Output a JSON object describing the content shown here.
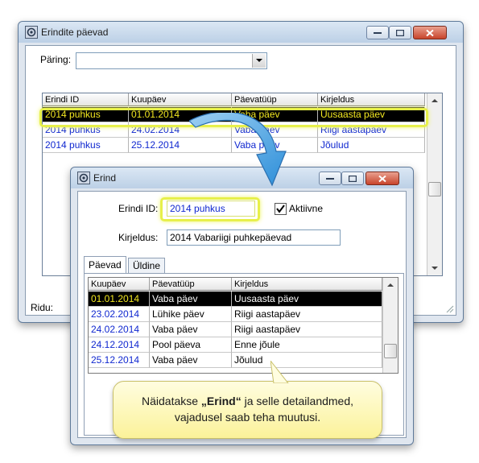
{
  "main_window": {
    "title": "Erindite päevad",
    "query_label": "Päring:",
    "query_value": "",
    "columns": [
      "Erindi ID",
      "Kuupäev",
      "Päevatüüp",
      "Kirjeldus"
    ],
    "rows": [
      [
        "2014 puhkus",
        "01.01.2014",
        "Vaba päev",
        "Uusaasta päev"
      ],
      [
        "2014 puhkus",
        "24.02.2014",
        "Vaba päev",
        "Riigi aastapäev"
      ],
      [
        "2014 puhkus",
        "25.12.2014",
        "Vaba päev",
        "Jõulud"
      ]
    ],
    "status_label": "Ridu:"
  },
  "detail_window": {
    "title": "Erind",
    "id_label": "Erindi ID:",
    "id_value": "2014 puhkus",
    "active_label": "Aktiivne",
    "active_checked": true,
    "desc_label": "Kirjeldus:",
    "desc_value": "2014 Vabariigi puhkepäevad",
    "tabs": [
      "Päevad",
      "Üldine"
    ],
    "columns": [
      "Kuupäev",
      "Päevatüüp",
      "Kirjeldus"
    ],
    "rows": [
      [
        "01.01.2014",
        "Vaba päev",
        "Uusaasta päev"
      ],
      [
        "23.02.2014",
        "Lühike päev",
        "Riigi aastapäev"
      ],
      [
        "24.02.2014",
        "Vaba päev",
        "Riigi aastapäev"
      ],
      [
        "24.12.2014",
        "Pool päeva",
        "Enne jõule"
      ],
      [
        "25.12.2014",
        "Vaba päev",
        "Jõulud"
      ]
    ]
  },
  "callout": {
    "line1_prefix": "Näidatakse ",
    "line1_bold": "„Erind“",
    "line1_suffix": " ja selle detailandmed,",
    "line2": "vajadusel saab teha muutusi."
  },
  "colors": {
    "selected_bg": "#000000",
    "selected_fg_yellow": "#f3e820",
    "row_text_blue": "#1028d0",
    "highlight_glow": "#e7f04a",
    "callout_bg": "#fbf29a",
    "arrow_blue": "#2e8fd9"
  }
}
